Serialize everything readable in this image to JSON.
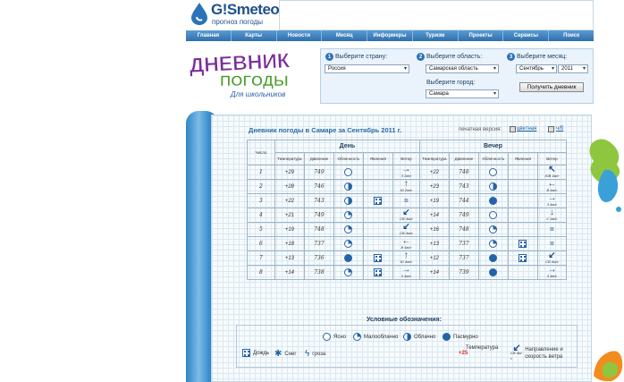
{
  "header": {
    "logo_title": "G!Smeteo",
    "logo_subtitle": "прогноз погоды"
  },
  "nav": {
    "items": [
      "Главная",
      "Карты",
      "Новости",
      "Месяц",
      "Информеры",
      "Туризм",
      "Проекты",
      "Сервисы",
      "Поиск"
    ]
  },
  "diary_logo": {
    "line1": "ДНЕВНИК",
    "line2": "ПОГОДЫ",
    "line3": "Для школьников"
  },
  "selector": {
    "step1_num": "1",
    "step1_label": "Выберите страну:",
    "country": "Россия",
    "step2_num": "2",
    "step2_label": "Выберите область:",
    "region": "Самарская область",
    "city_label": "Выберите город:",
    "city": "Самара",
    "step3_num": "3",
    "step3_label": "Выберите месяц:",
    "month": "Сентябрь",
    "year": "2011",
    "get_button": "Получить дневник"
  },
  "diary": {
    "title": "Дневник погоды в Самаре за Сентябрь 2011 г.",
    "print_label": "печатная версия:",
    "print_color": "цветная",
    "print_bw": "ч/б",
    "group_day": "День",
    "group_evening": "Вечер",
    "col_date": "Число",
    "col_temp": "Температура",
    "col_pressure": "Давление",
    "col_cloud": "Облачность",
    "col_phenomena": "Явления",
    "col_wind": "Ветер",
    "rows": [
      {
        "date": "1",
        "d_temp": "+29",
        "d_press": "749",
        "d_cloud": "clear",
        "d_ph": "",
        "d_wind_arrow": "→",
        "d_wind": "З 2м/с",
        "e_temp": "+22",
        "e_press": "748",
        "e_cloud": "clear",
        "e_ph": "",
        "e_wind_arrow": "↖",
        "e_wind": "ЮВ 4м/с"
      },
      {
        "date": "2",
        "d_temp": "+28",
        "d_press": "746",
        "d_cloud": "cloudy",
        "d_ph": "",
        "d_wind_arrow": "↑",
        "d_wind": "Ю 2м/с",
        "e_temp": "+23",
        "e_press": "743",
        "e_cloud": "cloudy",
        "e_ph": "",
        "e_wind_arrow": "←",
        "e_wind": "В 4м/с"
      },
      {
        "date": "3",
        "d_temp": "+22",
        "d_press": "743",
        "d_cloud": "cloudy",
        "d_ph": "rain",
        "d_wind_arrow": "=",
        "d_wind": "",
        "e_temp": "+19",
        "e_press": "744",
        "e_cloud": "overcast",
        "e_ph": "",
        "e_wind_arrow": "→",
        "e_wind": "З 4м/с"
      },
      {
        "date": "4",
        "d_temp": "+21",
        "d_press": "749",
        "d_cloud": "partly",
        "d_ph": "",
        "d_wind_arrow": "↙",
        "d_wind": "СВ 4м/с",
        "e_temp": "+14",
        "e_press": "749",
        "e_cloud": "clear",
        "e_ph": "",
        "e_wind_arrow": "↓",
        "e_wind": "С 4м/с"
      },
      {
        "date": "5",
        "d_temp": "+19",
        "d_press": "748",
        "d_cloud": "partly",
        "d_ph": "",
        "d_wind_arrow": "↙",
        "d_wind": "СВ 4м/с",
        "e_temp": "+16",
        "e_press": "748",
        "e_cloud": "partly",
        "e_ph": "",
        "e_wind_arrow": "=",
        "e_wind": ""
      },
      {
        "date": "6",
        "d_temp": "+18",
        "d_press": "737",
        "d_cloud": "partly",
        "d_ph": "",
        "d_wind_arrow": "←",
        "d_wind": "В 4м/с",
        "e_temp": "+13",
        "e_press": "737",
        "e_cloud": "partly",
        "e_ph": "rain",
        "e_wind_arrow": "=",
        "e_wind": ""
      },
      {
        "date": "7",
        "d_temp": "+13",
        "d_press": "736",
        "d_cloud": "overcast",
        "d_ph": "rain",
        "d_wind_arrow": "↑",
        "d_wind": "Ю 4м/с",
        "e_temp": "+12",
        "e_press": "737",
        "e_cloud": "overcast",
        "e_ph": "rain",
        "e_wind_arrow": "↙",
        "e_wind": "СВ 4м/с"
      },
      {
        "date": "8",
        "d_temp": "+14",
        "d_press": "738",
        "d_cloud": "partly",
        "d_ph": "rain",
        "d_wind_arrow": "→",
        "d_wind": "З 4м/с",
        "e_temp": "+14",
        "e_press": "739",
        "e_cloud": "overcast",
        "e_ph": "",
        "e_wind_arrow": "→",
        "e_wind": "З 4м/с"
      }
    ]
  },
  "legend": {
    "title": "Условные обозначения:",
    "clear": "Ясно",
    "partly": "Малооблачно",
    "cloudy": "Облачно",
    "overcast": "Пасмурно",
    "rain": "Дождь",
    "snow": "Снег",
    "storm": "гроза",
    "temp": "Температура",
    "temp_example": "+25",
    "wind_example": "СВ 4м/с",
    "wind": "Направление и скорость ветра"
  },
  "colors": {
    "accent": "#2d72b8",
    "temperature": "#e0262a",
    "nav": "#3a7fbf"
  }
}
